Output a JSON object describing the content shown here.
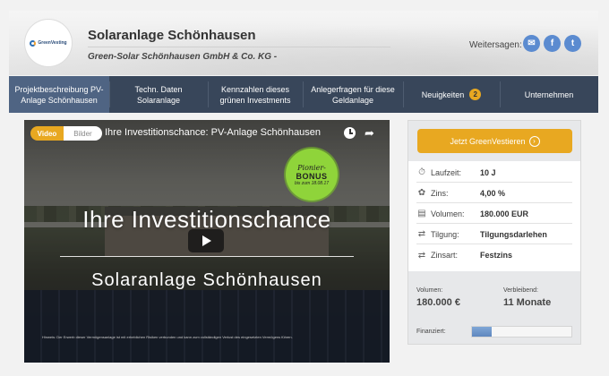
{
  "header": {
    "logo_text": "GreenVesting",
    "title": "Solaranlage Schönhausen",
    "subtitle": "Green-Solar Schönhausen GmbH & Co. KG -",
    "share_label": "Weitersagen:"
  },
  "share_buttons": [
    {
      "name": "email",
      "glyph": "✉"
    },
    {
      "name": "facebook",
      "glyph": "f"
    },
    {
      "name": "twitter",
      "glyph": "t"
    }
  ],
  "nav": {
    "items": [
      {
        "label": "Projektbeschreibung PV-Anlage Schönhausen",
        "active": true
      },
      {
        "label": "Techn. Daten Solaranlage"
      },
      {
        "label": "Kennzahlen dieses grünen Investments"
      },
      {
        "label": "Anlegerfragen für diese Geldanlage"
      },
      {
        "label": "Neuigkeiten",
        "badge": "2"
      },
      {
        "label": "Unternehmen"
      }
    ]
  },
  "video": {
    "tab_video": "Video",
    "tab_bilder": "Bilder",
    "title": "Ihre Investitionschance: PV-Anlage Schönhausen",
    "bonus_line1": "Pionier-",
    "bonus_line2": "BONUS",
    "bonus_line3": "bis zum 18.08.17",
    "headline": "Ihre Investitionschance",
    "subheadline": "Solaranlage Schönhausen",
    "disclaimer": "Hinweis: Der Erwerb dieser Vermögensanlage ist mit erheblichen Risiken verbunden und kann zum vollständigen Verlust des eingesetzten Vermögens führen."
  },
  "invest": {
    "button_label": "Jetzt GreenVestieren",
    "details": [
      {
        "icon": "clock-icon",
        "glyph": "⏱",
        "label": "Laufzeit:",
        "value": "10 J"
      },
      {
        "icon": "piggy-bank-icon",
        "glyph": "✿",
        "label": "Zins:",
        "value": "4,00 %"
      },
      {
        "icon": "money-icon",
        "glyph": "▤",
        "label": "Volumen:",
        "value": "180.000 EUR"
      },
      {
        "icon": "repeat-icon",
        "glyph": "⇄",
        "label": "Tilgung:",
        "value": "Tilgungsdarlehen"
      },
      {
        "icon": "repeat-icon",
        "glyph": "⇄",
        "label": "Zinsart:",
        "value": "Festzins"
      }
    ],
    "volumen_label": "Volumen:",
    "volumen_value": "180.000 €",
    "verbleibend_label": "Verbleibend:",
    "verbleibend_value": "11 Monate",
    "finanziert_label": "Finanziert:",
    "finanziert_fraction": 0.2
  },
  "colors": {
    "accent": "#e8a821",
    "nav_bg": "#38465a",
    "nav_active": "#4f6483",
    "share_blue": "#5b8bd0",
    "bonus_green": "#8fd43a"
  }
}
